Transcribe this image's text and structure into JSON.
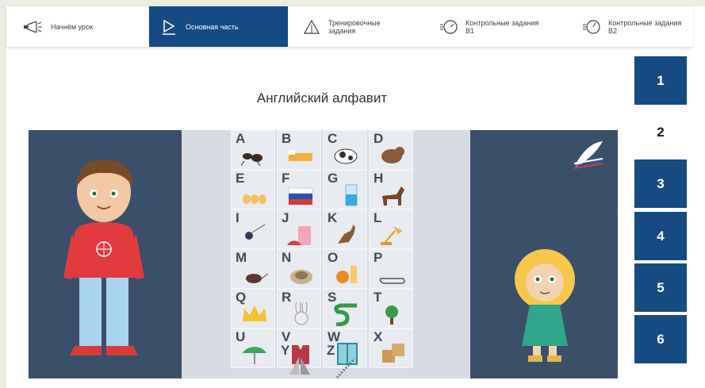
{
  "nav": {
    "tabs": [
      {
        "label": "Начнём урок",
        "icon": "megaphone-icon",
        "active": false
      },
      {
        "label": "Основная часть",
        "icon": "play-icon",
        "active": true
      },
      {
        "label": "Тренировочные задания",
        "icon": "triangle-icon",
        "active": false
      },
      {
        "label": "Контрольные задания В1",
        "icon": "timer-icon",
        "active": false
      },
      {
        "label": "Контрольные задания В2",
        "icon": "timer-icon",
        "active": false
      }
    ]
  },
  "slide_numbers": [
    "1",
    "2",
    "3",
    "4",
    "5",
    "6"
  ],
  "active_slide": "2",
  "slide": {
    "title": "Английский алфавит",
    "letters": [
      "A",
      "B",
      "C",
      "D",
      "E",
      "F",
      "G",
      "H",
      "I",
      "J",
      "K",
      "L",
      "M",
      "N",
      "O",
      "P",
      "Q",
      "R",
      "S",
      "T",
      "U",
      "V",
      "W",
      "X",
      "Y",
      "Z"
    ],
    "pictures": [
      "ant",
      "bed",
      "cow",
      "dog",
      "eggs",
      "flag",
      "glass",
      "horse",
      "ice",
      "jam",
      "kangaroo",
      "lamp",
      "mouse",
      "nest",
      "orange",
      "pin",
      "queen",
      "rabbit",
      "snake",
      "tree",
      "umbrella",
      "vest",
      "window",
      "box",
      "yacht",
      "zipper"
    ],
    "logo": "quill-logo"
  },
  "colors": {
    "accent": "#164a82",
    "slide_bg": "#3a4f6a",
    "panel_bg": "#d7dce2",
    "page_bg": "#e9ede2"
  }
}
